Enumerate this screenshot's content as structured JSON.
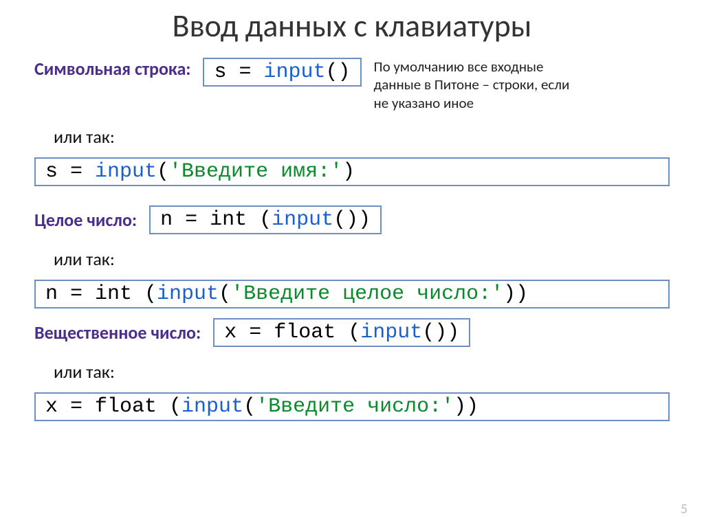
{
  "title": "Ввод данных с клавиатуры",
  "label_string": "Символьная строка:",
  "label_integer": "Целое число:",
  "label_real": "Вещественное число:",
  "label_or": "или так:",
  "note": "По умолчанию все входные данные в Питоне – строки, если не указано иное",
  "code1": {
    "a": "s = ",
    "b": "input",
    "c": "()"
  },
  "code2": {
    "a": "s = ",
    "b": "input",
    "c": "(",
    "d": "'Введите имя:'",
    "e": ")"
  },
  "code3": {
    "a": "n = int (",
    "b": "input",
    "c": "())"
  },
  "code4": {
    "a": "n = int (",
    "b": "input",
    "c": "(",
    "d": "'Введите целое число:'",
    "e": "))"
  },
  "code5": {
    "a": "x = float (",
    "b": "input",
    "c": "())"
  },
  "code6": {
    "a": "x = float (",
    "b": "input",
    "c": "(",
    "d": "'Введите число:'",
    "e": "))"
  },
  "pagenum": "5"
}
